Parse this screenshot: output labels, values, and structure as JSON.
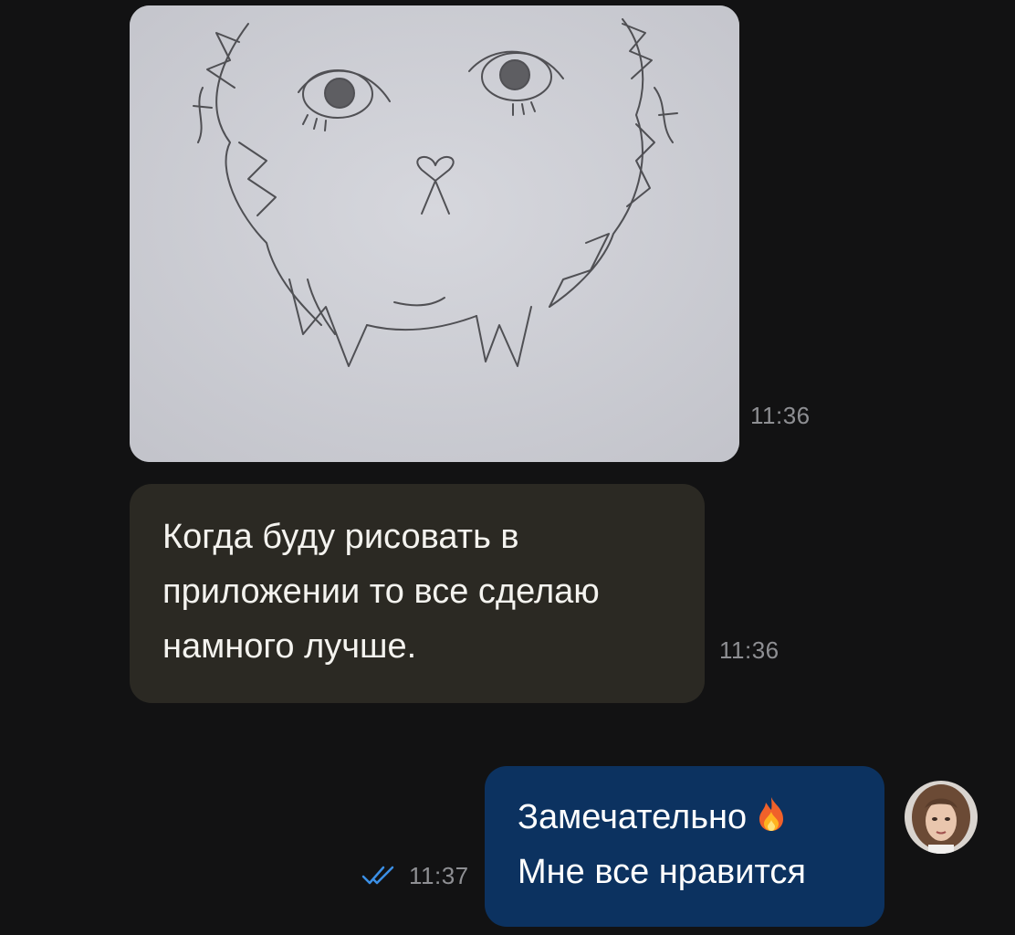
{
  "messages": [
    {
      "type": "image",
      "direction": "incoming",
      "time": "11:36",
      "image_description": "pencil-sketch-of-lion-face"
    },
    {
      "type": "text",
      "direction": "incoming",
      "lines": [
        "Когда буду рисовать в",
        "приложении то все сделаю",
        "намного лучше."
      ],
      "time": "11:36"
    },
    {
      "type": "text",
      "direction": "outgoing",
      "lines": [
        "Замечательно",
        "Мне все нравится"
      ],
      "emoji": "fire-icon",
      "time": "11:37",
      "status": "read-double-check"
    }
  ],
  "colors": {
    "background": "#121213",
    "incoming_bubble": "#2b2923",
    "outgoing_bubble": "#0c3260",
    "time_text": "#8e8f93",
    "read_check": "#3b8fe6"
  }
}
